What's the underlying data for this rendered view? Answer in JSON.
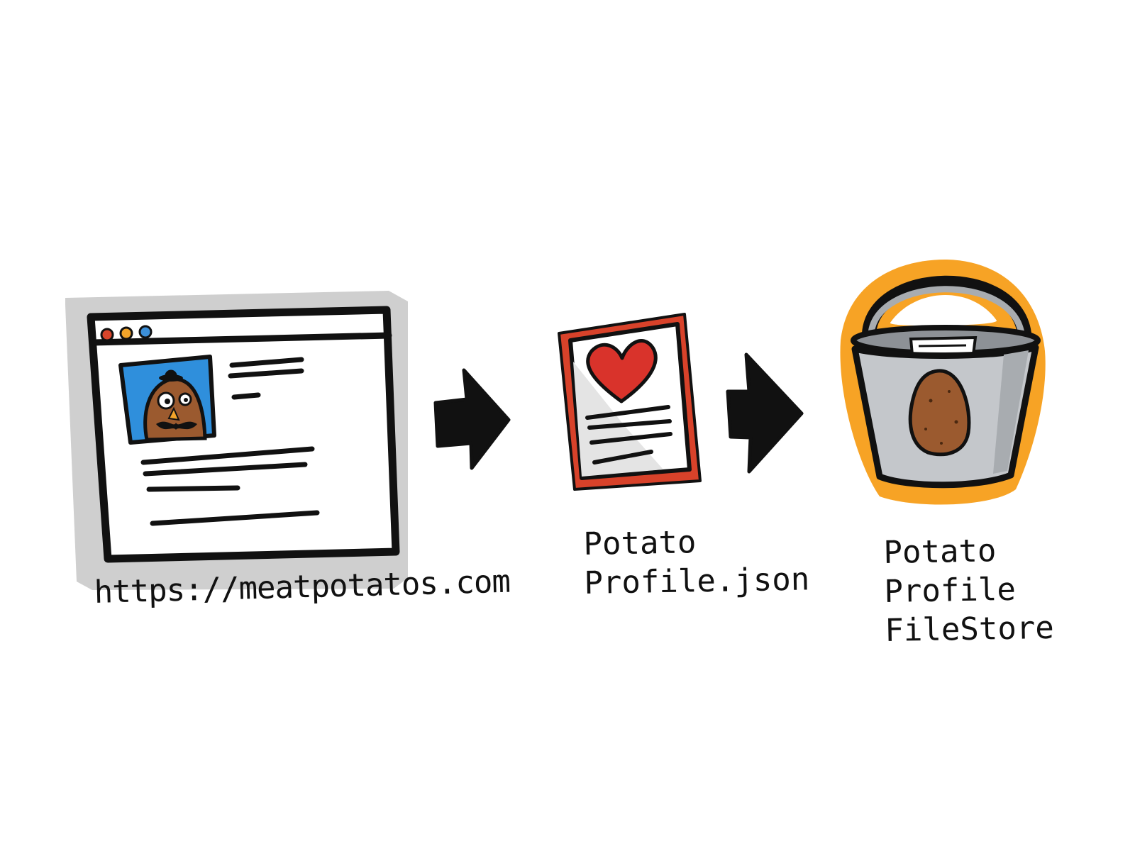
{
  "diagram": {
    "nodes": [
      {
        "id": "website",
        "icon": "browser-window-icon",
        "label_lines": [
          "https://meatpotatos.com"
        ]
      },
      {
        "id": "profile-json",
        "icon": "document-heart-icon",
        "label_lines": [
          "Potato",
          "Profile.json"
        ]
      },
      {
        "id": "file-store",
        "icon": "bucket-potato-icon",
        "label_lines": [
          "Potato",
          "Profile",
          "FileStore"
        ]
      }
    ],
    "edges": [
      {
        "from": "website",
        "to": "profile-json",
        "icon": "arrow-right-icon"
      },
      {
        "from": "profile-json",
        "to": "file-store",
        "icon": "arrow-right-icon"
      }
    ]
  },
  "colors": {
    "ink": "#111111",
    "browser_shadow": "#cfcfcf",
    "window_dot_red": "#d9452b",
    "window_dot_orange": "#f2a42a",
    "window_dot_blue": "#3c8fd8",
    "avatar_background": "#2f8fdc",
    "potato_brown": "#9b5a2f",
    "document_border": "#d8422a",
    "heart_red": "#d9332b",
    "bucket_glow": "#f7a325",
    "bucket_grey": "#c4c7cb"
  }
}
